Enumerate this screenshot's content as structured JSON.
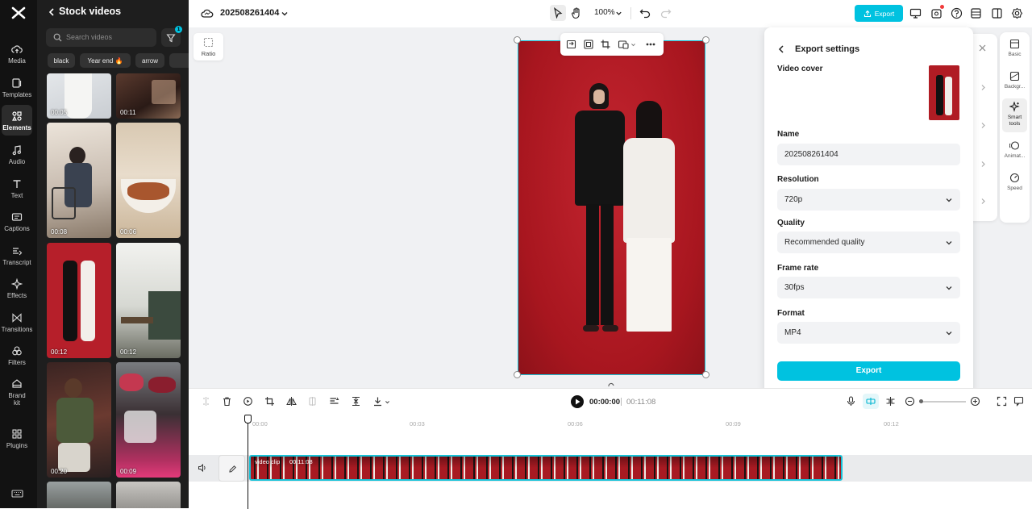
{
  "rail": {
    "items": [
      {
        "label": "Media",
        "icon": "cloud-upload-icon"
      },
      {
        "label": "Templates",
        "icon": "templates-icon"
      },
      {
        "label": "Elements",
        "icon": "elements-icon"
      },
      {
        "label": "Audio",
        "icon": "music-note-icon"
      },
      {
        "label": "Text",
        "icon": "text-icon"
      },
      {
        "label": "Captions",
        "icon": "captions-icon"
      },
      {
        "label": "Transcript",
        "icon": "transcript-icon"
      },
      {
        "label": "Effects",
        "icon": "sparkle-icon"
      },
      {
        "label": "Transitions",
        "icon": "transitions-icon"
      },
      {
        "label": "Filters",
        "icon": "filters-icon"
      },
      {
        "label": "Brand",
        "label2": "kit",
        "icon": "brand-kit-icon"
      },
      {
        "label": "Plugins",
        "icon": "plugins-icon"
      }
    ]
  },
  "panel": {
    "title": "Stock videos",
    "search_placeholder": "Search videos",
    "filter_badge": "1",
    "chips": [
      "black",
      "Year end 🔥",
      "arrow"
    ],
    "durations": [
      "00:05",
      "00:11",
      "00:08",
      "00:06",
      "00:12",
      "00:12",
      "00:20",
      "00:09"
    ]
  },
  "topbar": {
    "project_name": "202508261404",
    "zoom": "100%",
    "export_label": "Export"
  },
  "canvas": {
    "ratio_label": "Ratio"
  },
  "export_settings": {
    "title": "Export settings",
    "video_cover_label": "Video cover",
    "name_label": "Name",
    "name_value": "202508261404",
    "resolution_label": "Resolution",
    "resolution_value": "720p",
    "quality_label": "Quality",
    "quality_value": "Recommended quality",
    "framerate_label": "Frame rate",
    "framerate_value": "30fps",
    "format_label": "Format",
    "format_value": "MP4",
    "export_button": "Export"
  },
  "right_rail": {
    "items": [
      {
        "label": "Basic",
        "icon": "basic-icon"
      },
      {
        "label": "Backgr...",
        "icon": "background-icon"
      },
      {
        "label": "Smart tools",
        "icon": "smart-tools-icon"
      },
      {
        "label": "Animat...",
        "icon": "animation-icon"
      },
      {
        "label": "Speed",
        "icon": "speed-icon"
      }
    ]
  },
  "timeline": {
    "current_time": "00:00:00",
    "total_time": "00:11:08",
    "ticks": [
      "00:00",
      "00:03",
      "00:06",
      "00:09",
      "00:12"
    ],
    "clip_label": "video clip",
    "clip_duration": "00:11:08"
  },
  "colors": {
    "accent": "#00c2e0",
    "video_bg": "#b01c24",
    "rail_bg": "#121212",
    "panel_bg": "#1e1e1e"
  }
}
